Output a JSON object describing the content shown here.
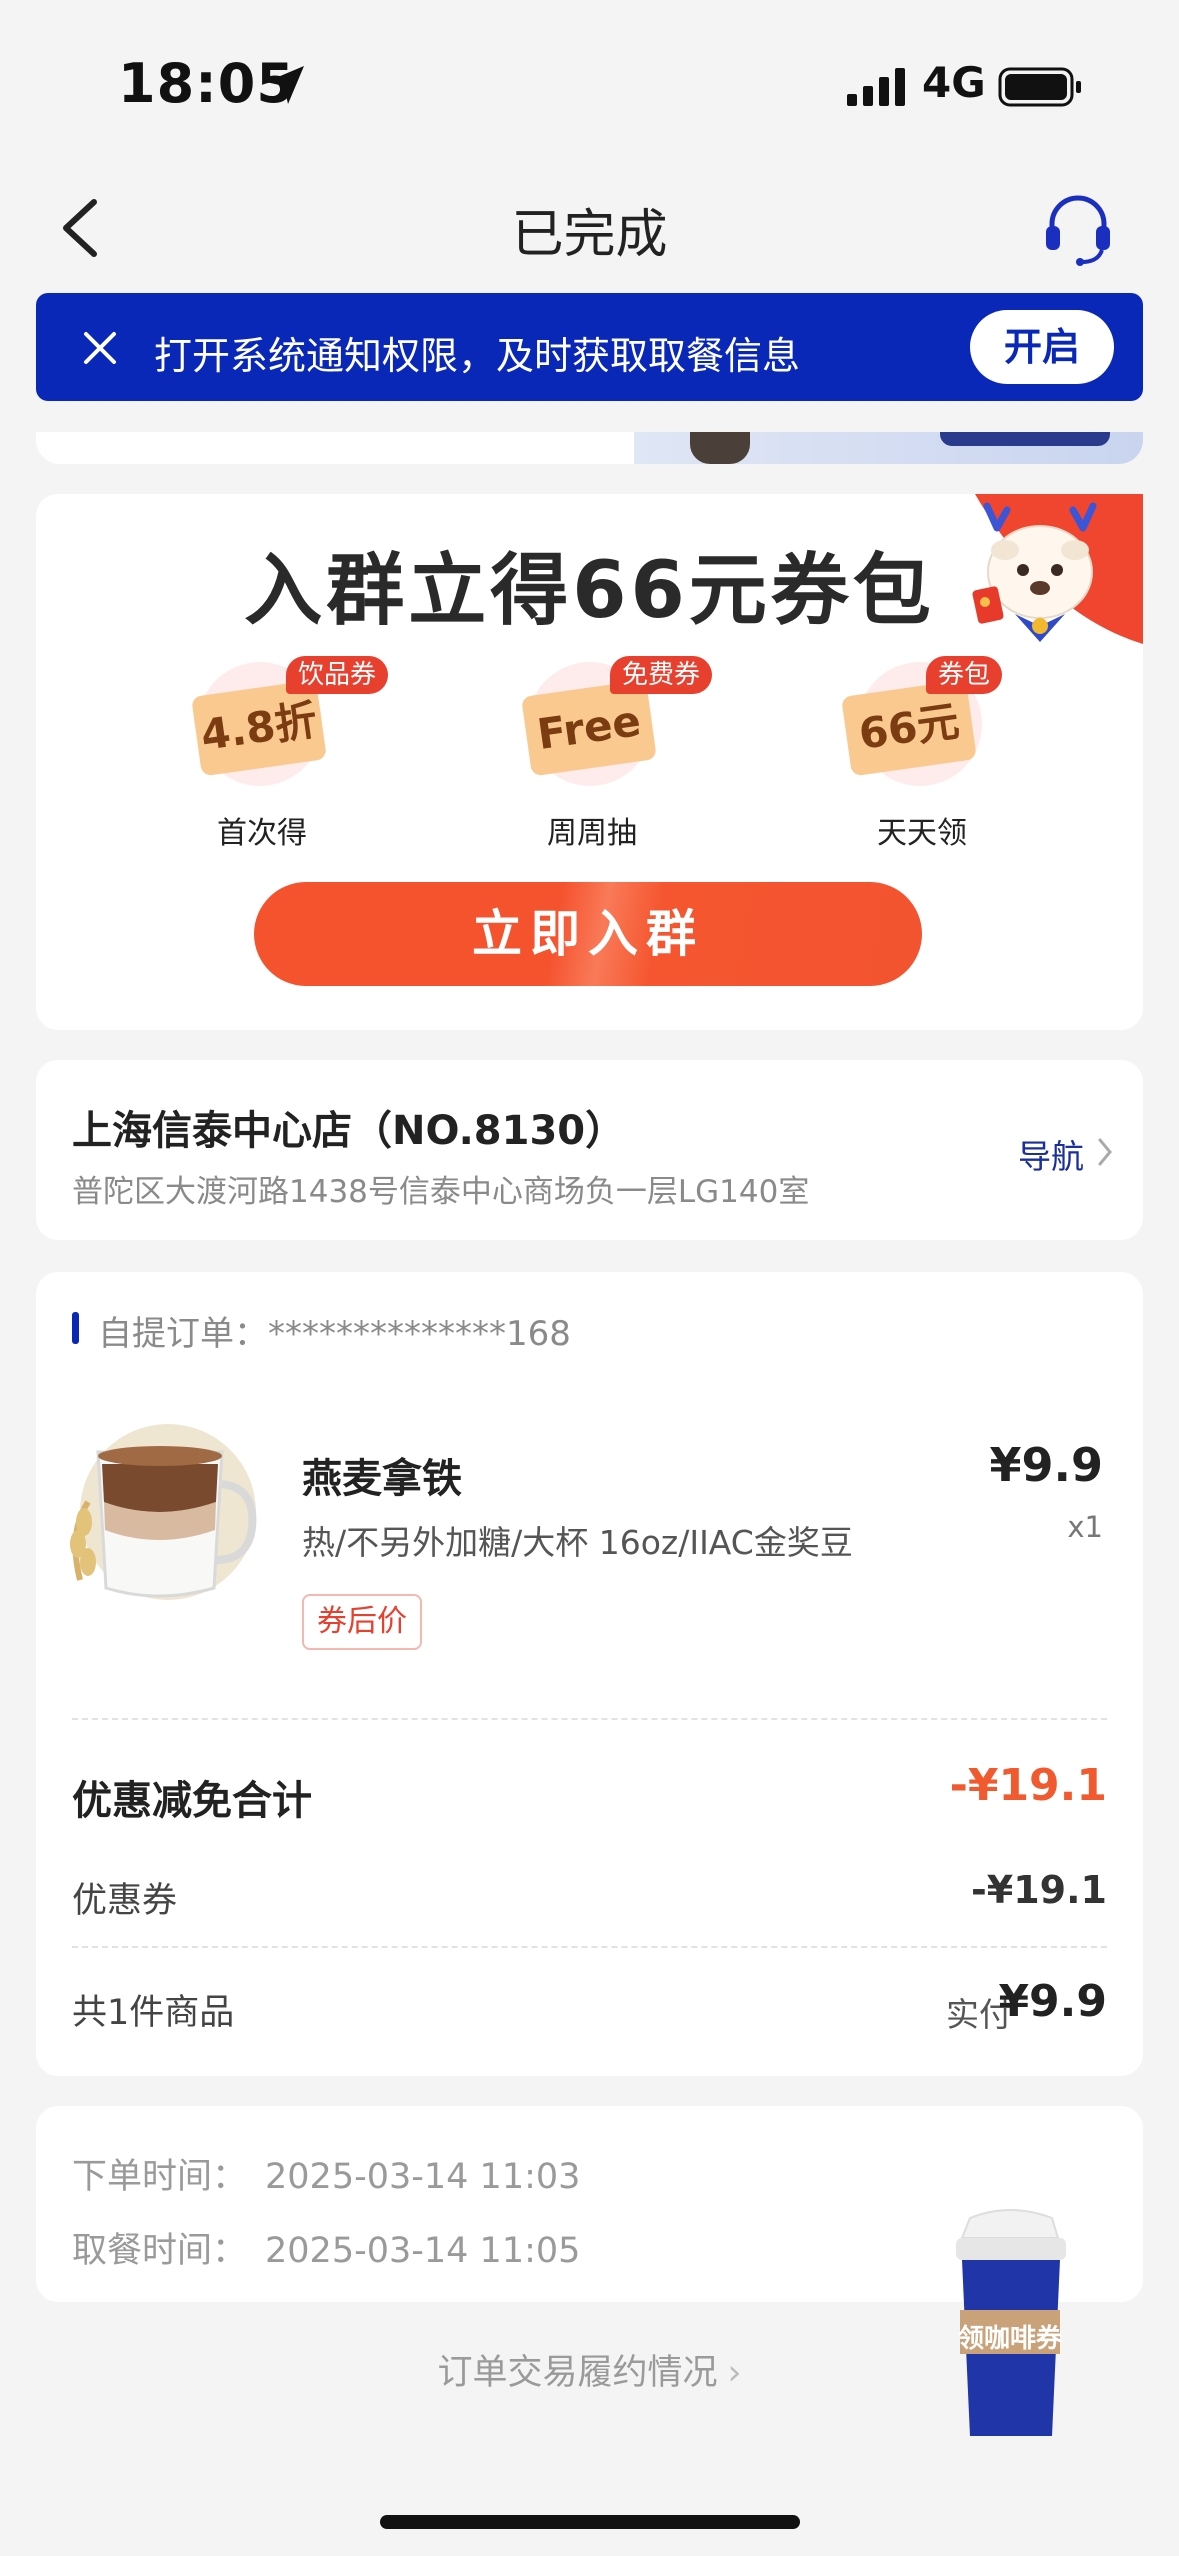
{
  "status_bar": {
    "time": "18:05",
    "network": "4G"
  },
  "nav": {
    "title": "已完成"
  },
  "notice": {
    "text": "打开系统通知权限，及时获取取餐信息",
    "button": "开启"
  },
  "group": {
    "title": "入群立得66元券包",
    "coupons": [
      {
        "tag": "饮品券",
        "ticket": "4.8折",
        "label": "首次得"
      },
      {
        "tag": "免费券",
        "ticket": "Free",
        "label": "周周抽"
      },
      {
        "tag": "券包",
        "ticket": "66元",
        "label": "天天领"
      }
    ],
    "join_button": "立即入群"
  },
  "store": {
    "name": "上海信泰中心店（NO.8130）",
    "address": "普陀区大渡河路1438号信泰中心商场负一层LG140室",
    "nav_label": "导航"
  },
  "order": {
    "number_label": "自提订单：",
    "number": "**************168",
    "product": {
      "name": "燕麦拿铁",
      "spec": "热/不另外加糖/大杯 16oz/IIAC金奖豆",
      "tag": "券后价",
      "price": "¥9.9",
      "qty": "x1"
    },
    "discount_title": "优惠减免合计",
    "discount_total": "-¥19.1",
    "coupon_label": "优惠券",
    "coupon_value": "-¥19.1",
    "items_count": "共1件商品",
    "paid_label": "实付",
    "paid_amount": "¥9.9"
  },
  "times": {
    "order_label": "下单时间：",
    "order_time": "2025-03-14 11:03",
    "pickup_label": "取餐时间：",
    "pickup_time": "2025-03-14 11:05"
  },
  "float_cup_text": "领咖啡券",
  "trade_link": "订单交易履约情况"
}
